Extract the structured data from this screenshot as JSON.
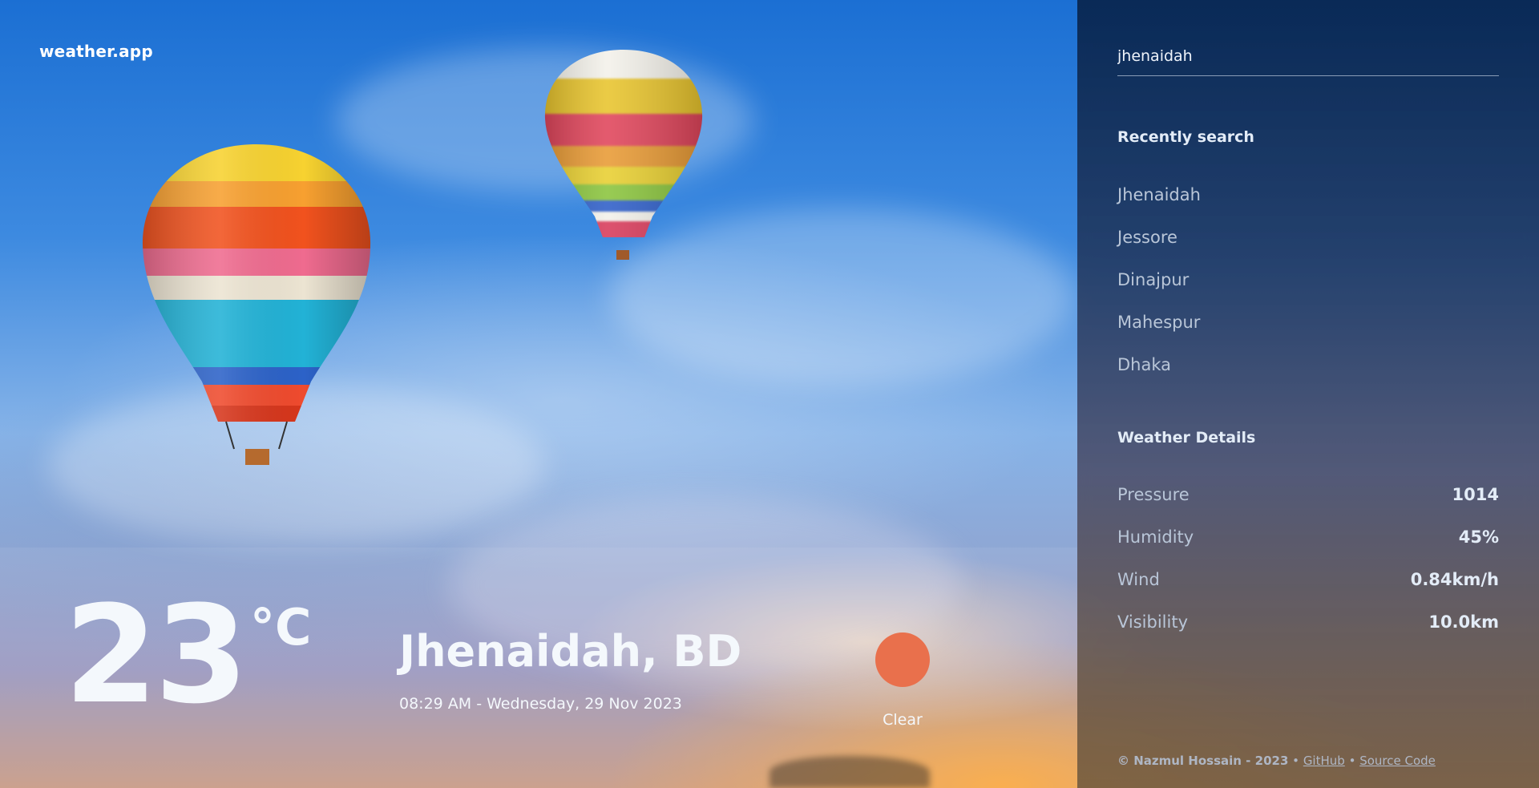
{
  "app": {
    "brand": "weather.app"
  },
  "current": {
    "temperature": "23",
    "unit": "°C",
    "location": "Jhenaidah, BD",
    "datetime": "08:29 AM - Wednesday, 29 Nov 2023",
    "condition": "Clear",
    "condition_icon": "sun-icon",
    "condition_color": "#e9704c"
  },
  "sidebar": {
    "search": {
      "value": "jhenaidah"
    },
    "recent_title": "Recently search",
    "recent": [
      "Jhenaidah",
      "Jessore",
      "Dinajpur",
      "Mahespur",
      "Dhaka"
    ],
    "details_title": "Weather Details",
    "details": [
      {
        "label": "Pressure",
        "value": "1014"
      },
      {
        "label": "Humidity",
        "value": "45%"
      },
      {
        "label": "Wind",
        "value": "0.84km/h"
      },
      {
        "label": "Visibility",
        "value": "10.0km"
      }
    ],
    "footer": {
      "credit": "© Nazmul Hossain - 2023",
      "separator": "•",
      "link1": "GitHub",
      "link2": "Source Code"
    }
  }
}
